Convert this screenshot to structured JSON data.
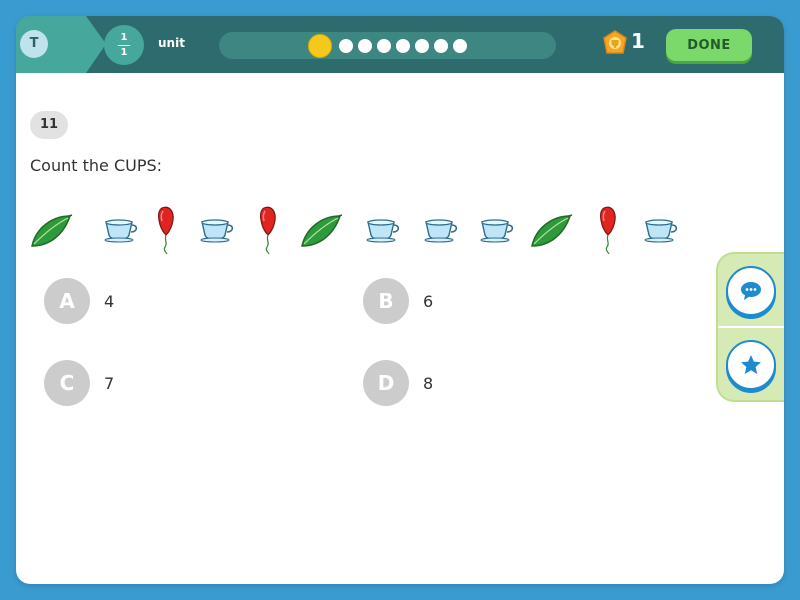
{
  "header": {
    "user_initial": "T",
    "unit_fraction": {
      "numerator": "1",
      "denominator": "1"
    },
    "unit_label": "unit",
    "progress": {
      "total_steps": 7,
      "current_step": 1
    },
    "reward_count": "1",
    "done_label": "DONE"
  },
  "question": {
    "number": "11",
    "prompt": "Count the CUPS:",
    "items": [
      "leaf",
      "cup",
      "balloon",
      "cup",
      "balloon",
      "leaf",
      "cup",
      "cup",
      "cup",
      "leaf",
      "balloon",
      "cup"
    ]
  },
  "choices": [
    {
      "letter": "A",
      "value": "4"
    },
    {
      "letter": "B",
      "value": "6"
    },
    {
      "letter": "C",
      "value": "7"
    },
    {
      "letter": "D",
      "value": "8"
    }
  ],
  "side_panel": {
    "icons": [
      "chat-icon",
      "star-icon"
    ]
  },
  "colors": {
    "page_background": "#3a9bd0",
    "header_background": "#2e6b6e",
    "accent_teal": "#46a89d",
    "done_button": "#7bd86a",
    "choice_circle": "#cccccc",
    "side_panel": "#d5eab4",
    "side_button_accent": "#1e8ad0"
  }
}
